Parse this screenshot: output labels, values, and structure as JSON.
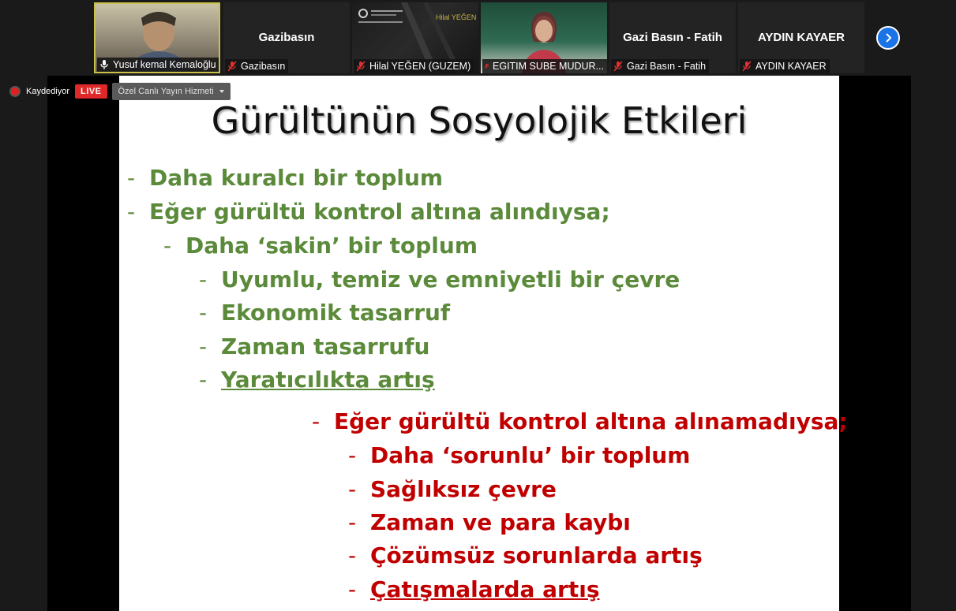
{
  "participants": [
    {
      "name": "Yusuf kemal Kemaloğlu",
      "center_name": "",
      "mic": "unmuted",
      "video": true
    },
    {
      "name": "Gazibasın",
      "center_name": "Gazibasın",
      "mic": "muted",
      "video": false
    },
    {
      "name": "Hilal YEĞEN (GUZEM)",
      "center_name": "",
      "mic": "muted",
      "video": true,
      "overlay_text": "Hilal YEĞEN"
    },
    {
      "name": "EGITIM SUBE MUDUR...",
      "center_name": "",
      "mic": "muted",
      "video": true
    },
    {
      "name": "Gazi Basın - Fatih",
      "center_name": "Gazi Basın - Fatih",
      "mic": "muted",
      "video": false
    },
    {
      "name": "AYDIN KAYAER",
      "center_name": "AYDIN KAYAER",
      "mic": "muted",
      "video": false
    }
  ],
  "recording": {
    "status_text": "Kaydediyor",
    "live_label": "LIVE",
    "service_label": "Özel Canlı Yayın Hizmeti"
  },
  "slide": {
    "title": "Gürültünün Sosyolojik Etkileri",
    "dash": "-",
    "lines": [
      "Daha kuralcı bir toplum",
      "Eğer gürültü kontrol altına alındıysa;",
      "Daha ‘sakin’ bir toplum",
      "Uyumlu, temiz ve emniyetli bir  çevre",
      "Ekonomik tasarruf",
      "Zaman tasarrufu",
      "Yaratıcılıkta artış",
      "Eğer gürültü kontrol altına alınamadıysa;",
      "Daha ‘sorunlu’ bir toplum",
      "Sağlıksız çevre",
      "Zaman ve para kaybı",
      "Çözümsüz sorunlarda artış",
      "Çatışmalarda artış"
    ]
  },
  "colors": {
    "green": "#5b8a3a",
    "red": "#c00000",
    "live": "#e02828",
    "next_button": "#1b73e8"
  },
  "icons": {
    "mic_on": "mic-icon",
    "mic_off": "mic-muted-icon",
    "next": "chevron-right-icon",
    "record": "record-dot-icon"
  }
}
